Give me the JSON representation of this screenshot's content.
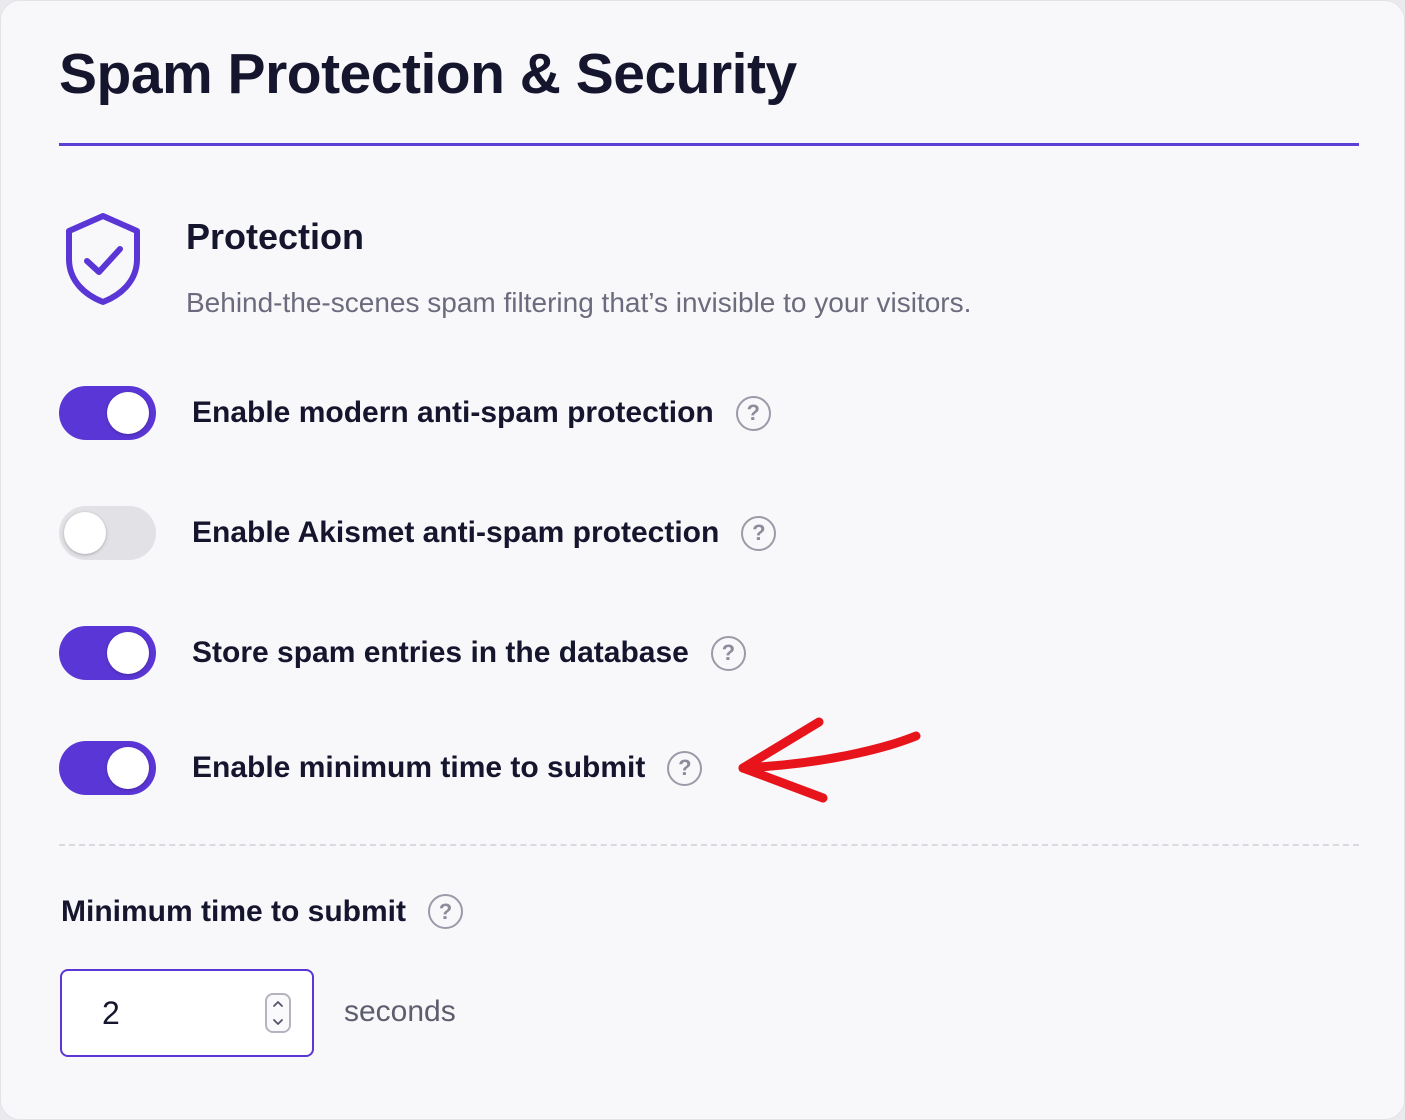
{
  "page": {
    "title": "Spam Protection & Security"
  },
  "section": {
    "icon": "shield-check-icon",
    "title": "Protection",
    "description": "Behind-the-scenes spam filtering that’s invisible to your visitors."
  },
  "settings": [
    {
      "label": "Enable modern anti-spam protection",
      "enabled": true,
      "help_icon": "question-circle-icon"
    },
    {
      "label": "Enable Akismet anti-spam protection",
      "enabled": false,
      "help_icon": "question-circle-icon"
    },
    {
      "label": "Store spam entries in the database",
      "enabled": true,
      "help_icon": "question-circle-icon"
    },
    {
      "label": "Enable minimum time to submit",
      "enabled": true,
      "help_icon": "question-circle-icon"
    }
  ],
  "min_time": {
    "label": "Minimum time to submit",
    "value": "2",
    "unit": "seconds"
  },
  "help": {
    "glyph": "?"
  },
  "annotation": {
    "icon": "red-arrow-icon"
  },
  "colors": {
    "accent": "#5b36d6",
    "toggle_off": "#e1e1e6",
    "annotation": "#e8141c"
  }
}
